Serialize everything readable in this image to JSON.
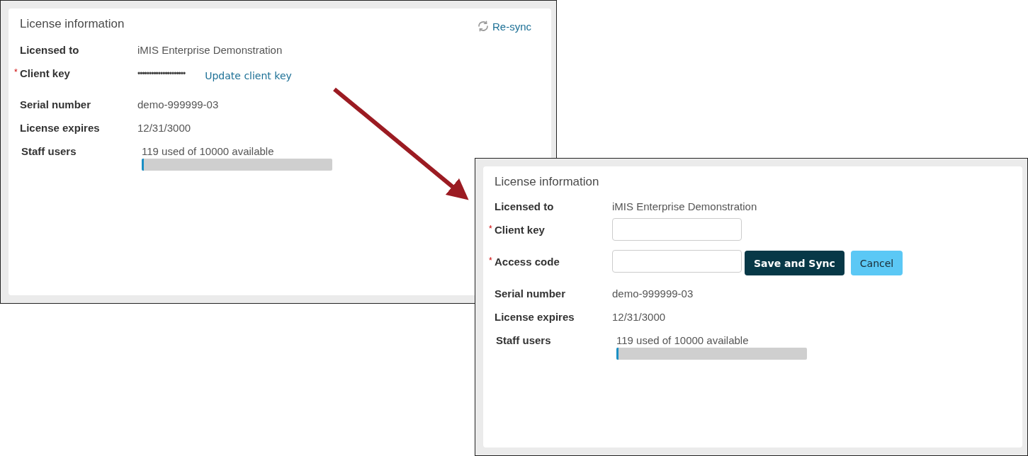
{
  "panels": [
    {
      "title": "License information",
      "resync": {
        "label": "Re-sync"
      },
      "rows": [
        {
          "kind": "text",
          "label": "Licensed to",
          "value": "iMIS Enterprise Demonstration"
        },
        {
          "kind": "masked",
          "label": "Client key",
          "required_mark": "*",
          "value": "•••••••••••••••••••••",
          "link": "Update client key"
        },
        {
          "kind": "text",
          "label": "Serial number",
          "value": "demo-999999-03"
        },
        {
          "kind": "text",
          "label": "License expires",
          "value": "12/31/3000"
        },
        {
          "kind": "meter",
          "label": "Staff users",
          "value": "119 used of 10000 available",
          "level": 0.0119
        }
      ]
    },
    {
      "title": "License information",
      "rows": [
        {
          "kind": "text",
          "label": "Licensed to",
          "value": "iMIS Enterprise Demonstration"
        },
        {
          "kind": "input",
          "label": "Client key",
          "required_mark": "*"
        },
        {
          "kind": "input",
          "label": "Access code",
          "required_mark": "*",
          "buttons": [
            {
              "label": "Save and Sync",
              "kind": "primary"
            },
            {
              "label": "Cancel",
              "kind": "secondary"
            }
          ]
        },
        {
          "kind": "text",
          "label": "Serial number",
          "value": "demo-999999-03"
        },
        {
          "kind": "text",
          "label": "License expires",
          "value": "12/31/3000"
        },
        {
          "kind": "meter",
          "label": "Staff users",
          "value": "119 used of 10000 available",
          "level": 0.0119
        }
      ]
    }
  ]
}
